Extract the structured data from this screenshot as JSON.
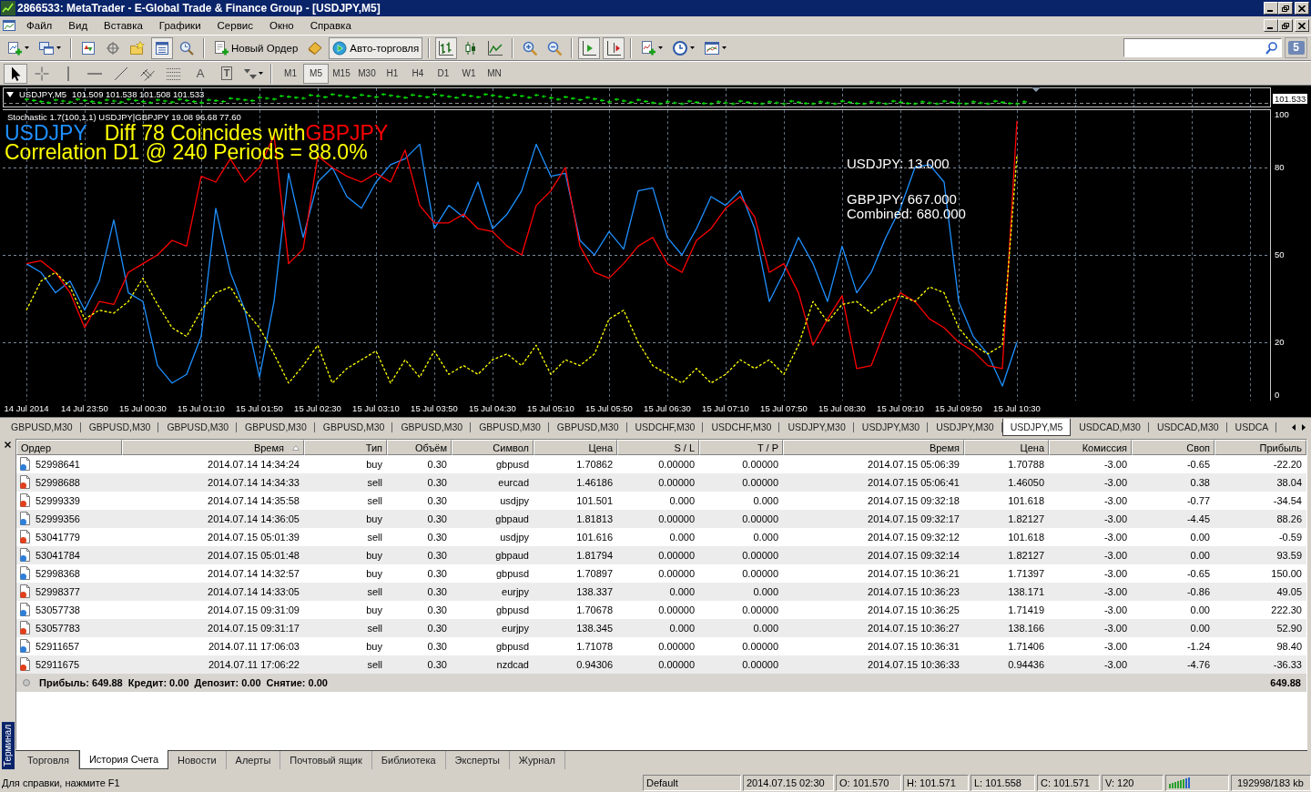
{
  "window": {
    "title": "2866533: MetaTrader - E-Global Trade & Finance Group - [USDJPY,M5]"
  },
  "menu": {
    "items": [
      "Файл",
      "Вид",
      "Вставка",
      "Графики",
      "Сервис",
      "Окно",
      "Справка"
    ]
  },
  "toolbar": {
    "groups": [
      [
        {
          "kind": "new-chart",
          "menu": true,
          "pressed": false
        },
        {
          "kind": "profiles",
          "menu": true,
          "pressed": false
        }
      ],
      [
        {
          "kind": "market-watch",
          "menu": false,
          "pressed": false
        },
        {
          "kind": "navigator",
          "menu": false,
          "pressed": false
        },
        {
          "kind": "favorites",
          "menu": false,
          "pressed": false
        },
        {
          "kind": "terminal",
          "menu": false,
          "pressed": true
        },
        {
          "kind": "tester",
          "menu": false,
          "pressed": false
        }
      ],
      [
        {
          "kind": "new-order",
          "label": "Новый Ордер",
          "menu": false,
          "pressed": false
        },
        {
          "kind": "editor",
          "menu": false,
          "pressed": false
        },
        {
          "kind": "auto-trading",
          "label": "Авто-торговля",
          "menu": false,
          "pressed": true
        }
      ],
      [
        {
          "kind": "bars",
          "menu": false,
          "pressed": true
        },
        {
          "kind": "candles",
          "menu": false,
          "pressed": false
        },
        {
          "kind": "line",
          "menu": false,
          "pressed": false
        }
      ],
      [
        {
          "kind": "zoom-in",
          "menu": false,
          "pressed": false
        },
        {
          "kind": "zoom-out",
          "menu": false,
          "pressed": false
        }
      ],
      [
        {
          "kind": "autoscroll",
          "menu": false,
          "pressed": true
        },
        {
          "kind": "shift",
          "menu": false,
          "pressed": true
        }
      ],
      [
        {
          "kind": "indicators",
          "menu": true,
          "pressed": false
        },
        {
          "kind": "periods",
          "menu": true,
          "pressed": false
        },
        {
          "kind": "templates",
          "menu": true,
          "pressed": false
        }
      ]
    ],
    "messages_count": "5"
  },
  "drawing_tools": [
    {
      "kind": "cursor",
      "selected": true,
      "menu": false
    },
    {
      "kind": "crosshair",
      "selected": false,
      "menu": false
    },
    {
      "kind": "vline",
      "selected": false,
      "menu": false
    },
    {
      "kind": "hline",
      "selected": false,
      "menu": false
    },
    {
      "kind": "trendline",
      "selected": false,
      "menu": false
    },
    {
      "kind": "channel",
      "selected": false,
      "menu": false
    },
    {
      "kind": "fibo",
      "selected": false,
      "menu": false
    },
    {
      "kind": "text",
      "glyph": "A",
      "selected": false,
      "menu": false
    },
    {
      "kind": "label",
      "glyph": "T",
      "selected": false,
      "menu": false
    },
    {
      "kind": "arrows",
      "selected": false,
      "menu": true
    }
  ],
  "timeframes": [
    {
      "label": "M1",
      "selected": false
    },
    {
      "label": "M5",
      "selected": true
    },
    {
      "label": "M15",
      "selected": false
    },
    {
      "label": "M30",
      "selected": false
    },
    {
      "label": "H1",
      "selected": false
    },
    {
      "label": "H4",
      "selected": false
    },
    {
      "label": "D1",
      "selected": false
    },
    {
      "label": "W1",
      "selected": false
    },
    {
      "label": "MN",
      "selected": false
    }
  ],
  "chart": {
    "symbol": "USDJPY,M5",
    "quote_values": "101.509 101.538 101.508 101.533",
    "price_label": "101.533",
    "indicator": {
      "headline": [
        {
          "text": "USDJPY",
          "color": "#1e90ff"
        },
        {
          "text": "Diff 78 Coincides with",
          "color": "#ffff00"
        },
        {
          "text": "GBPJPY",
          "color": "#ff0000"
        }
      ],
      "subline": "Correlation D1 @ 240 Periods = 88.0%",
      "chart_data": [
        {
          "type": "line",
          "title": "Stochastic 1.7(100,1,1) USDJPY|GBPJPY 19.08 96.68 77.60",
          "categories": [
            "14 Jul 2014",
            null,
            null,
            null,
            "14 Jul 23:50",
            null,
            null,
            null,
            "15 Jul 00:30",
            null,
            null,
            null,
            "15 Jul 01:10",
            null,
            null,
            null,
            "15 Jul 01:50",
            null,
            null,
            null,
            "15 Jul 02:30",
            null,
            null,
            null,
            "15 Jul 03:10",
            null,
            null,
            null,
            "15 Jul 03:50",
            null,
            null,
            null,
            "15 Jul 04:30",
            null,
            null,
            null,
            "15 Jul 05:10",
            null,
            null,
            null,
            "15 Jul 05:50",
            null,
            null,
            null,
            "15 Jul 06:30",
            null,
            null,
            null,
            "15 Jul 07:10",
            null,
            null,
            null,
            "15 Jul 07:50",
            null,
            null,
            null,
            "15 Jul 08:30",
            null,
            null,
            null,
            "15 Jul 09:10",
            null,
            null,
            null,
            "15 Jul 09:50",
            null,
            null,
            null,
            "15 Jul 10:30"
          ],
          "series": [
            {
              "color": "#1e90ff",
              "values": [
                47,
                44,
                37,
                41,
                31,
                41,
                62,
                37,
                34,
                12,
                6,
                9,
                22,
                66,
                44,
                31,
                8,
                34,
                78,
                56,
                75,
                80,
                70,
                66,
                75,
                81,
                83,
                88,
                59,
                67,
                63,
                75,
                59,
                64,
                72,
                88,
                77,
                78,
                55,
                50,
                58,
                52,
                72,
                73,
                56,
                50,
                59,
                70,
                67,
                72,
                59,
                34,
                44,
                56,
                47,
                34,
                53,
                37,
                44,
                56,
                66,
                80,
                81,
                75,
                34,
                22,
                16,
                5,
                20
              ]
            },
            {
              "color": "#ff0000",
              "values": [
                47,
                48,
                44,
                37,
                25,
                34,
                33,
                44,
                47,
                50,
                55,
                53,
                77,
                75,
                83,
                75,
                80,
                91,
                47,
                52,
                84,
                80,
                77,
                75,
                78,
                75,
                86,
                67,
                61,
                61,
                64,
                59,
                58,
                53,
                50,
                67,
                72,
                80,
                53,
                44,
                42,
                47,
                53,
                56,
                47,
                44,
                55,
                59,
                66,
                70,
                63,
                44,
                47,
                37,
                19,
                28,
                36,
                11,
                12,
                25,
                37,
                34,
                28,
                25,
                20,
                17,
                12,
                11,
                96
              ]
            },
            {
              "color": "#ffff00",
              "line_style": "dashed",
              "values": [
                31,
                41,
                44,
                39,
                28,
                31,
                30,
                34,
                42,
                33,
                25,
                22,
                31,
                37,
                39,
                31,
                25,
                16,
                6,
                12,
                19,
                6,
                11,
                14,
                17,
                6,
                14,
                8,
                17,
                9,
                12,
                9,
                14,
                16,
                12,
                19,
                9,
                14,
                12,
                16,
                28,
                31,
                20,
                12,
                9,
                6,
                11,
                6,
                9,
                14,
                11,
                14,
                9,
                19,
                34,
                27,
                33,
                34,
                30,
                34,
                36,
                34,
                39,
                37,
                25,
                19,
                16,
                19,
                84
              ]
            }
          ],
          "ylim": [
            0,
            100
          ],
          "yticks": [
            0,
            20,
            50,
            80,
            100
          ],
          "grid": true,
          "annotations": [
            "USDJPY: 13.000",
            "GBPJPY: 667.000",
            "Combined: 680.000"
          ]
        }
      ]
    }
  },
  "chart_tabs": [
    {
      "label": "GBPUSD,M30",
      "selected": false
    },
    {
      "label": "GBPUSD,M30",
      "selected": false
    },
    {
      "label": "GBPUSD,M30",
      "selected": false
    },
    {
      "label": "GBPUSD,M30",
      "selected": false
    },
    {
      "label": "GBPUSD,M30",
      "selected": false
    },
    {
      "label": "GBPUSD,M30",
      "selected": false
    },
    {
      "label": "GBPUSD,M30",
      "selected": false
    },
    {
      "label": "GBPUSD,M30",
      "selected": false
    },
    {
      "label": "USDCHF,M30",
      "selected": false
    },
    {
      "label": "USDCHF,M30",
      "selected": false
    },
    {
      "label": "USDJPY,M30",
      "selected": false
    },
    {
      "label": "USDJPY,M30",
      "selected": false
    },
    {
      "label": "USDJPY,M30",
      "selected": false
    },
    {
      "label": "USDJPY,M5",
      "selected": true
    },
    {
      "label": "USDCAD,M30",
      "selected": false
    },
    {
      "label": "USDCAD,M30",
      "selected": false
    },
    {
      "label": "USDCA",
      "selected": false
    }
  ],
  "terminal": {
    "title": "Терминал",
    "columns": [
      {
        "label": "Ордер",
        "sorted": false
      },
      {
        "label": "Время",
        "sorted": true
      },
      {
        "label": "Тип",
        "sorted": false
      },
      {
        "label": "Объём",
        "sorted": false
      },
      {
        "label": "Символ",
        "sorted": false
      },
      {
        "label": "Цена",
        "sorted": false
      },
      {
        "label": "S / L",
        "sorted": false
      },
      {
        "label": "T / P",
        "sorted": false
      },
      {
        "label": "Время",
        "sorted": false
      },
      {
        "label": "Цена",
        "sorted": false
      },
      {
        "label": "Комиссия",
        "sorted": false
      },
      {
        "label": "Своп",
        "sorted": false
      },
      {
        "label": "Прибыль",
        "sorted": false
      }
    ],
    "rows": [
      {
        "color": "#2f7fd8",
        "cells": [
          "52998641",
          "2014.07.14 14:34:24",
          "buy",
          "0.30",
          "gbpusd",
          "1.70862",
          "0.00000",
          "0.00000",
          "2014.07.15 05:06:39",
          "1.70788",
          "-3.00",
          "-0.65",
          "-22.20"
        ]
      },
      {
        "color": "#e0401c",
        "cells": [
          "52998688",
          "2014.07.14 14:34:33",
          "sell",
          "0.30",
          "eurcad",
          "1.46186",
          "0.00000",
          "0.00000",
          "2014.07.15 05:06:41",
          "1.46050",
          "-3.00",
          "0.38",
          "38.04"
        ]
      },
      {
        "color": "#e0401c",
        "cells": [
          "52999339",
          "2014.07.14 14:35:58",
          "sell",
          "0.30",
          "usdjpy",
          "101.501",
          "0.000",
          "0.000",
          "2014.07.15 09:32:18",
          "101.618",
          "-3.00",
          "-0.77",
          "-34.54"
        ]
      },
      {
        "color": "#2f7fd8",
        "cells": [
          "52999356",
          "2014.07.14 14:36:05",
          "buy",
          "0.30",
          "gbpaud",
          "1.81813",
          "0.00000",
          "0.00000",
          "2014.07.15 09:32:17",
          "1.82127",
          "-3.00",
          "-4.45",
          "88.26"
        ]
      },
      {
        "color": "#e0401c",
        "cells": [
          "53041779",
          "2014.07.15 05:01:39",
          "sell",
          "0.30",
          "usdjpy",
          "101.616",
          "0.000",
          "0.000",
          "2014.07.15 09:32:12",
          "101.618",
          "-3.00",
          "0.00",
          "-0.59"
        ]
      },
      {
        "color": "#2f7fd8",
        "cells": [
          "53041784",
          "2014.07.15 05:01:48",
          "buy",
          "0.30",
          "gbpaud",
          "1.81794",
          "0.00000",
          "0.00000",
          "2014.07.15 09:32:14",
          "1.82127",
          "-3.00",
          "0.00",
          "93.59"
        ]
      },
      {
        "color": "#2f7fd8",
        "cells": [
          "52998368",
          "2014.07.14 14:32:57",
          "buy",
          "0.30",
          "gbpusd",
          "1.70897",
          "0.00000",
          "0.00000",
          "2014.07.15 10:36:21",
          "1.71397",
          "-3.00",
          "-0.65",
          "150.00"
        ]
      },
      {
        "color": "#e0401c",
        "cells": [
          "52998377",
          "2014.07.14 14:33:05",
          "sell",
          "0.30",
          "eurjpy",
          "138.337",
          "0.000",
          "0.000",
          "2014.07.15 10:36:23",
          "138.171",
          "-3.00",
          "-0.86",
          "49.05"
        ]
      },
      {
        "color": "#2f7fd8",
        "cells": [
          "53057738",
          "2014.07.15 09:31:09",
          "buy",
          "0.30",
          "gbpusd",
          "1.70678",
          "0.00000",
          "0.00000",
          "2014.07.15 10:36:25",
          "1.71419",
          "-3.00",
          "0.00",
          "222.30"
        ]
      },
      {
        "color": "#e0401c",
        "cells": [
          "53057783",
          "2014.07.15 09:31:17",
          "sell",
          "0.30",
          "eurjpy",
          "138.345",
          "0.000",
          "0.000",
          "2014.07.15 10:36:27",
          "138.166",
          "-3.00",
          "0.00",
          "52.90"
        ]
      },
      {
        "color": "#2f7fd8",
        "cells": [
          "52911657",
          "2014.07.11 17:06:03",
          "buy",
          "0.30",
          "gbpusd",
          "1.71078",
          "0.00000",
          "0.00000",
          "2014.07.15 10:36:31",
          "1.71406",
          "-3.00",
          "-1.24",
          "98.40"
        ]
      },
      {
        "color": "#e0401c",
        "cells": [
          "52911675",
          "2014.07.11 17:06:22",
          "sell",
          "0.30",
          "nzdcad",
          "0.94306",
          "0.00000",
          "0.00000",
          "2014.07.15 10:36:33",
          "0.94436",
          "-3.00",
          "-4.76",
          "-36.33"
        ]
      }
    ],
    "summary": {
      "items": [
        "Прибыль: 649.88",
        "Кредит: 0.00",
        "Депозит: 0.00",
        "Снятие: 0.00"
      ],
      "total": "649.88"
    },
    "tabs": [
      {
        "label": "Торговля",
        "selected": false
      },
      {
        "label": "История Счета",
        "selected": true
      },
      {
        "label": "Новости",
        "selected": false
      },
      {
        "label": "Алерты",
        "selected": false
      },
      {
        "label": "Почтовый ящик",
        "selected": false
      },
      {
        "label": "Библиотека",
        "selected": false
      },
      {
        "label": "Эксперты",
        "selected": false
      },
      {
        "label": "Журнал",
        "selected": false
      }
    ]
  },
  "status_bar": {
    "help": "Для справки, нажмите F1",
    "sections": [
      "Default",
      "2014.07.15 02:30",
      "O: 101.570",
      "H: 101.571",
      "L: 101.558",
      "C: 101.571",
      "V: 120"
    ],
    "traffic": "192998/183 kb"
  }
}
